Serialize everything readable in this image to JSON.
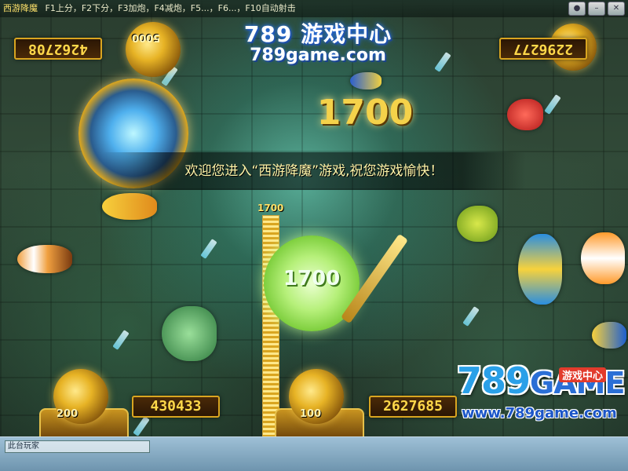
{
  "window": {
    "game_name": "西游降魔",
    "hotkeys": "F1上分，F2下分，F3加炮，F4减炮，F5...，F6...，F10自动射击"
  },
  "brand": {
    "title": "789 游戏中心",
    "url": "789game.com"
  },
  "scores": {
    "top_left": "4262708",
    "top_right": "2296277",
    "bottom_left": "430433",
    "bottom_center": "2627685"
  },
  "cannons": {
    "bottom_left_level": "200",
    "bottom_center_level": "100",
    "top_left_level": "5000"
  },
  "popup": {
    "big_score": "1700",
    "meter_value": "1700",
    "wheel_value": "1700"
  },
  "welcome_message": "欢迎您进入“西游降魔”游戏,祝您游戏愉快！",
  "logo": {
    "main": "789",
    "game": "GAME",
    "tag": "游戏中心",
    "url": "www.789game.com"
  },
  "bottom": {
    "chat_text": "此台玩家"
  },
  "colors": {
    "gold": "#ffd84a",
    "logo_blue": "#2aa0e8",
    "welcome_text": "#fff4a8"
  }
}
